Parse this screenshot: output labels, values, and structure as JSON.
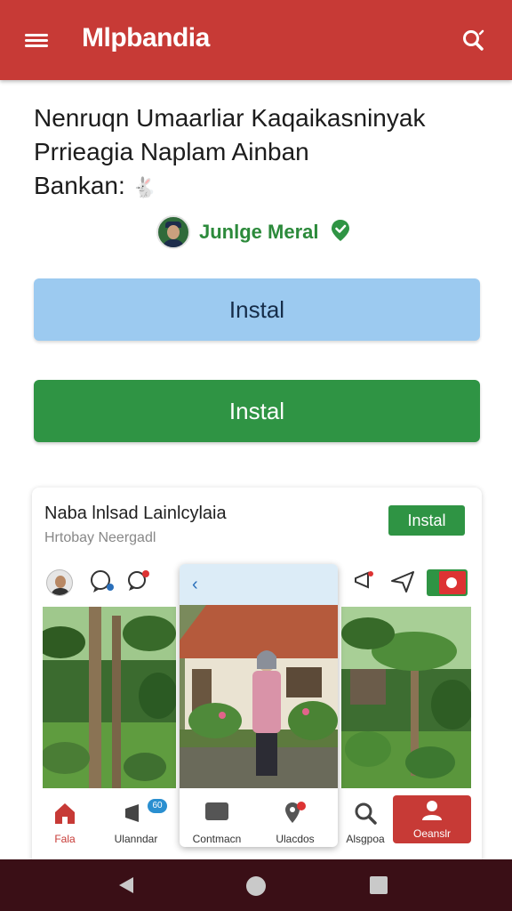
{
  "app": {
    "title": "Mlpbandia"
  },
  "headline": {
    "line1": "Nenruqn Umaarliar Kaqaikasninyak",
    "line2": "Prrieagia Naplam Ainban",
    "line3": "Bankan:",
    "emoji": "🐇"
  },
  "author": {
    "name": "Junlge Meral"
  },
  "buttons": {
    "primary_light": "Instal",
    "primary_green": "Instal"
  },
  "card": {
    "title": "Naba lnlsad Lainlcylaia",
    "subtitle": "Hrtobay Neergadl",
    "install_label": "Instal",
    "badge_count": "60",
    "nav": [
      {
        "label": "Fala",
        "icon": "home-icon"
      },
      {
        "label": "Ulanndar",
        "icon": "megaphone-icon"
      },
      {
        "label": "Contmacn",
        "icon": "chat-icon"
      },
      {
        "label": "Ulacdos",
        "icon": "location-icon"
      },
      {
        "label": "Alsgpoa",
        "icon": "search-icon"
      },
      {
        "label": "Oeanslr",
        "icon": "profile-icon"
      }
    ]
  },
  "colors": {
    "brand_red": "#c73a36",
    "green": "#2f9444",
    "light_blue": "#9ccaf0",
    "system_bar": "#3a0f16"
  }
}
